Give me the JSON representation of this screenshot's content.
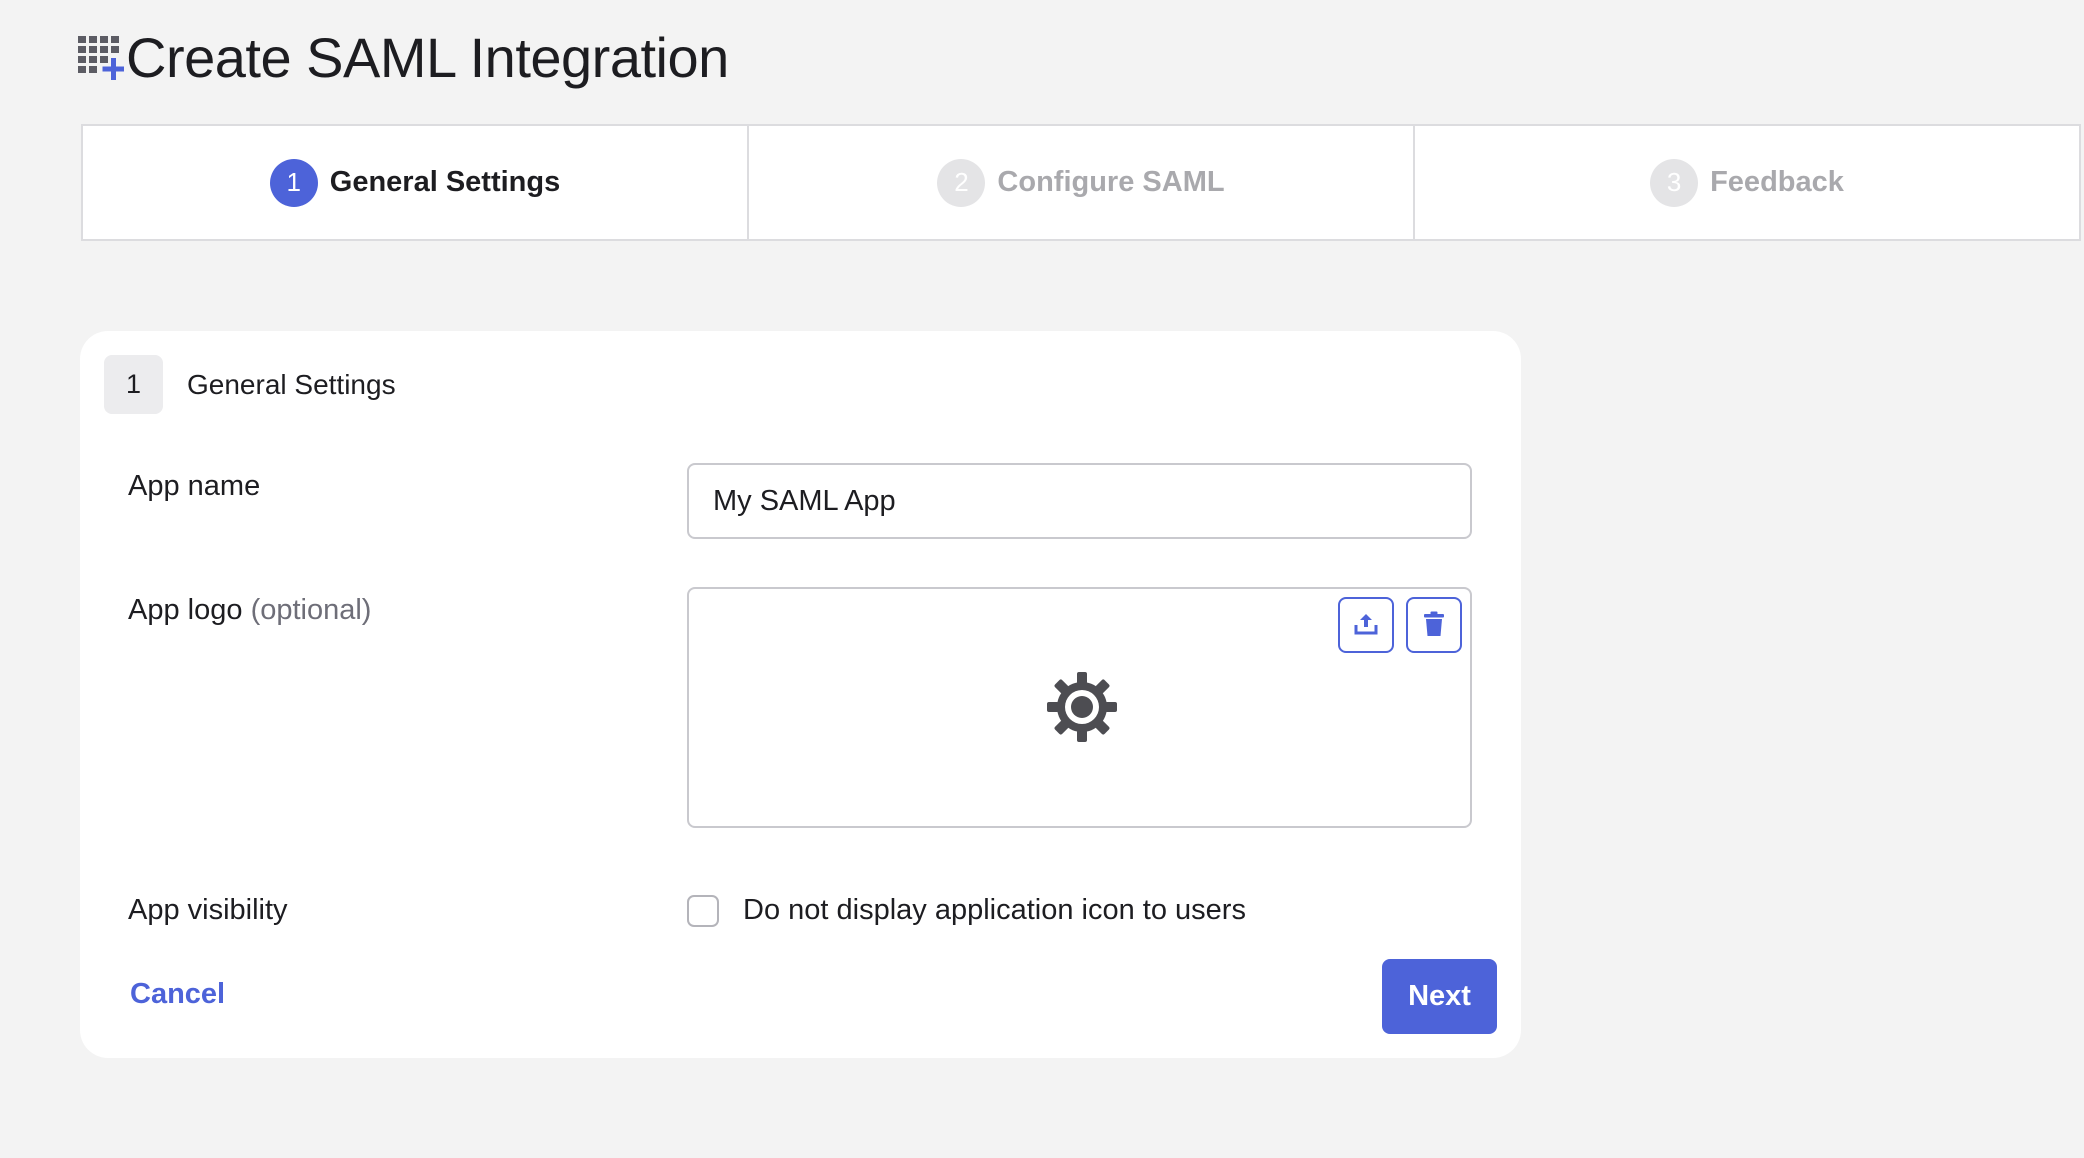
{
  "header": {
    "title": "Create SAML Integration",
    "icon": "app-grid-add-icon"
  },
  "stepper": {
    "steps": [
      {
        "number": "1",
        "label": "General Settings",
        "state": "active"
      },
      {
        "number": "2",
        "label": "Configure SAML",
        "state": "inactive"
      },
      {
        "number": "3",
        "label": "Feedback",
        "state": "inactive"
      }
    ]
  },
  "form": {
    "section_number": "1",
    "section_title": "General Settings",
    "app_name": {
      "label": "App name",
      "value": "My SAML App"
    },
    "app_logo": {
      "label": "App logo",
      "optional": "(optional)",
      "upload_icon": "upload-icon",
      "delete_icon": "trash-icon",
      "placeholder_icon": "gear-icon"
    },
    "app_visibility": {
      "label": "App visibility",
      "checkbox_label": "Do not display application icon to users",
      "checked": false
    },
    "cancel_label": "Cancel",
    "next_label": "Next"
  },
  "colors": {
    "accent": "#4d63d9",
    "background": "#f3f3f3",
    "inactive_step": "#a9a9ad"
  }
}
